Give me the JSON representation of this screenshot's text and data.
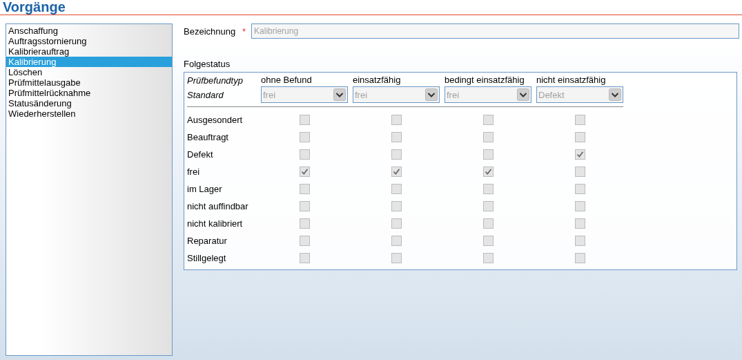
{
  "title": "Vorgänge",
  "list": [
    {
      "label": "Anschaffung",
      "selected": false
    },
    {
      "label": "Auftragsstornierung",
      "selected": false
    },
    {
      "label": "Kalibrierauftrag",
      "selected": false
    },
    {
      "label": "Kalibrierung",
      "selected": true
    },
    {
      "label": "Löschen",
      "selected": false
    },
    {
      "label": "Prüfmittelausgabe",
      "selected": false
    },
    {
      "label": "Prüfmittelrücknahme",
      "selected": false
    },
    {
      "label": "Statusänderung",
      "selected": false
    },
    {
      "label": "Wiederherstellen",
      "selected": false
    }
  ],
  "bezeichnung": {
    "label": "Bezeichnung",
    "required_mark": "*",
    "placeholder": "Kalibrierung"
  },
  "folgestatus": {
    "title": "Folgestatus",
    "type_label": "Prüfbefundtyp",
    "standard_label": "Standard",
    "disabled": true,
    "columns": [
      {
        "heading": "ohne Befund",
        "value": "frei",
        "disabled": true
      },
      {
        "heading": "einsatzfähig",
        "value": "frei",
        "disabled": true
      },
      {
        "heading": "bedingt einsatzfähig",
        "value": "frei",
        "disabled": true
      },
      {
        "heading": "nicht einsatzfähig",
        "value": "Defekt",
        "disabled": true
      }
    ],
    "rows": [
      {
        "label": "Ausgesondert",
        "checked": [
          false,
          false,
          false,
          false
        ]
      },
      {
        "label": "Beauftragt",
        "checked": [
          false,
          false,
          false,
          false
        ]
      },
      {
        "label": "Defekt",
        "checked": [
          false,
          false,
          false,
          true
        ]
      },
      {
        "label": "frei",
        "checked": [
          true,
          true,
          true,
          false
        ]
      },
      {
        "label": "im Lager",
        "checked": [
          false,
          false,
          false,
          false
        ]
      },
      {
        "label": "nicht auffindbar",
        "checked": [
          false,
          false,
          false,
          false
        ]
      },
      {
        "label": "nicht kalibriert",
        "checked": [
          false,
          false,
          false,
          false
        ]
      },
      {
        "label": "Reparatur",
        "checked": [
          false,
          false,
          false,
          false
        ]
      },
      {
        "label": "Stillgelegt",
        "checked": [
          false,
          false,
          false,
          false
        ]
      }
    ]
  }
}
